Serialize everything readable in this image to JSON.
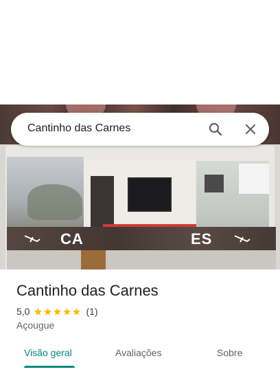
{
  "search": {
    "query": "Cantinho das Carnes"
  },
  "icons": {
    "search": "search-icon",
    "close": "close-icon",
    "star": "star-icon"
  },
  "photo": {
    "sign_left": "CA",
    "sign_right": "ES"
  },
  "place": {
    "name": "Cantinho das Carnes",
    "rating": "5,0",
    "stars": 5,
    "review_count": "(1)",
    "category": "Açougue"
  },
  "tabs": [
    {
      "label": "Visão geral",
      "active": true
    },
    {
      "label": "Avaliações",
      "active": false
    },
    {
      "label": "Sobre",
      "active": false
    }
  ],
  "colors": {
    "accent": "#00897b",
    "star": "#fbbc04",
    "text": "#202124",
    "muted": "#5f6368"
  }
}
